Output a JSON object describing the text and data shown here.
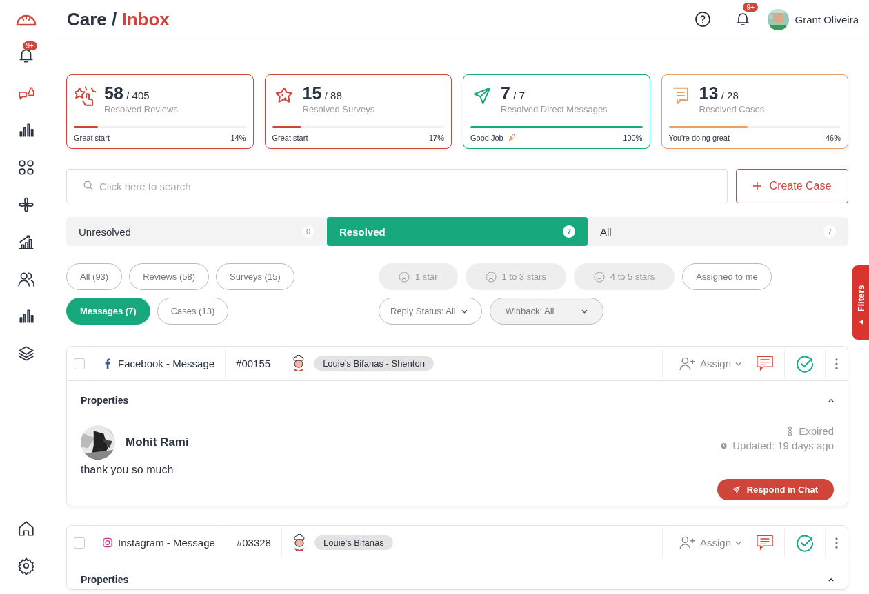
{
  "header": {
    "section": "Care /",
    "page": "Inbox",
    "notification_badge": "9+",
    "user_name": "Grant Oliveira"
  },
  "sidebar": {
    "notification_badge": "9+",
    "items": [
      {
        "selected": false
      },
      {
        "selected": true
      },
      {
        "selected": false
      },
      {
        "selected": false
      },
      {
        "selected": false
      },
      {
        "selected": false
      },
      {
        "selected": false
      },
      {
        "selected": false
      },
      {
        "selected": false
      },
      {
        "selected": false
      },
      {
        "selected": false
      }
    ]
  },
  "stats": [
    {
      "count": "58",
      "total": "/ 405",
      "label": "Resolved Reviews",
      "status": "Great start",
      "celebration": false,
      "percent": "14%",
      "level": 0.14,
      "color": "#d0453a"
    },
    {
      "count": "15",
      "total": "/ 88",
      "label": "Resolved Surveys",
      "status": "Great start",
      "celebration": false,
      "percent": "17%",
      "level": 0.17,
      "color": "#d0453a"
    },
    {
      "count": "7",
      "total": "/ 7",
      "label": "Resolved Direct Messages",
      "status": "Good Job",
      "celebration": true,
      "percent": "100%",
      "level": 1,
      "color": "#17a97d"
    },
    {
      "count": "13",
      "total": "/ 28",
      "label": "Resolved Cases",
      "status": "You're doing great",
      "celebration": false,
      "percent": "46%",
      "level": 0.46,
      "color": "#e8a06a"
    }
  ],
  "search": {
    "placeholder": "Click here to search"
  },
  "create_button": "Create Case",
  "status_tabs": [
    {
      "label": "Unresolved",
      "count": "0",
      "selected": false
    },
    {
      "label": "Resolved",
      "count": "7",
      "selected": true
    },
    {
      "label": "All",
      "count": "7",
      "selected": false
    }
  ],
  "type_filters": [
    {
      "label": "All (93)",
      "selected": false
    },
    {
      "label": "Reviews (58)",
      "selected": false
    },
    {
      "label": "Surveys (15)",
      "selected": false
    },
    {
      "label": "Messages (7)",
      "selected": true
    },
    {
      "label": "Cases (13)",
      "selected": false
    }
  ],
  "rating_filters": [
    {
      "label": "1 star",
      "kind": "sad",
      "disabled": true
    },
    {
      "label": "1 to 3 stars",
      "kind": "sad",
      "disabled": true
    },
    {
      "label": "4 to 5 stars",
      "kind": "happy",
      "disabled": true
    },
    {
      "label": "Assigned to me",
      "kind": "plain",
      "disabled": false
    }
  ],
  "dropdowns": [
    {
      "label": "Reply Status: All"
    },
    {
      "label": "Winback: All"
    }
  ],
  "filters_tab": "Filters",
  "messages": [
    {
      "checked": false,
      "kind": "facebook",
      "source": "Facebook - Message",
      "number": "#00155",
      "location": "Louie's Bifanas - Shenton",
      "assign": "Assign",
      "resolved": true,
      "properties": "Properties",
      "expanded": true,
      "author": "Mohit Rami",
      "status": "Expired",
      "updated": "Updated: 19 days ago",
      "text": "thank you so much",
      "action": "Respond in Chat"
    },
    {
      "checked": false,
      "kind": "instagram",
      "source": "Instagram - Message",
      "number": "#03328",
      "location": "Louie's Bifanas",
      "assign": "Assign",
      "resolved": true,
      "properties": "Properties",
      "expanded": true
    }
  ]
}
